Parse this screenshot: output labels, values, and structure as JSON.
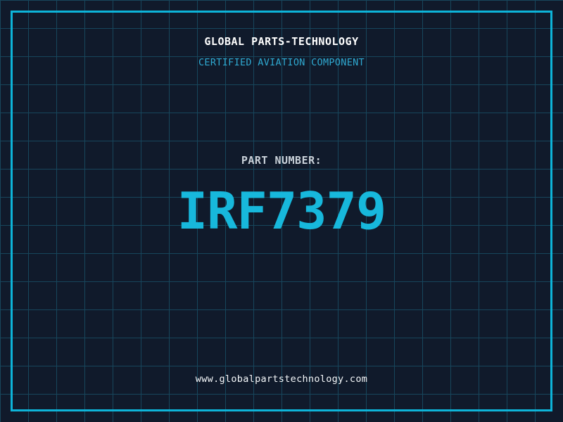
{
  "brand": {
    "title": "GLOBAL PARTS-TECHNOLOGY",
    "subtitle": "CERTIFIED AVIATION COMPONENT"
  },
  "part": {
    "label": "PART NUMBER:",
    "number": "IRF7379"
  },
  "footer": {
    "website": "www.globalpartstechnology.com"
  },
  "colors": {
    "bg": "#101a2b",
    "grid": "#17465c",
    "frame": "#0db4d9",
    "title": "#ffffff",
    "subtitle": "#2fa9d1",
    "part_label": "#c9d1d9",
    "part_number": "#17b8dc",
    "website": "#f5f8fa"
  }
}
